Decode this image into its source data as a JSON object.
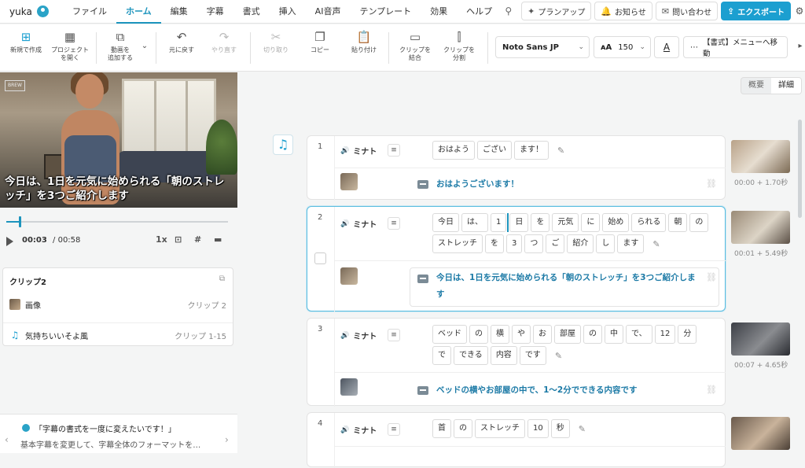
{
  "user": {
    "name": "yuka"
  },
  "menu": [
    "ファイル",
    "ホーム",
    "編集",
    "字幕",
    "書式",
    "挿入",
    "AI音声",
    "テンプレート",
    "効果",
    "ヘルプ"
  ],
  "header_actions": {
    "plan": "プランアップ",
    "notice": "お知らせ",
    "contact": "問い合わせ",
    "export": "エクスポート"
  },
  "toolbar": {
    "new": "新規で作成",
    "open": [
      "プロジェクト",
      "を開く"
    ],
    "add_video": [
      "動画を",
      "追加する"
    ],
    "undo": "元に戻す",
    "redo": "やり直す",
    "cut": "切り取り",
    "copy": "コピー",
    "paste": "貼り付け",
    "merge": [
      "クリップを",
      "結合"
    ],
    "split": [
      "クリップを",
      "分割"
    ],
    "font": "Noto Sans JP",
    "font_size": "150",
    "format_menu": "【書式】メニューへ移動"
  },
  "preview": {
    "caption": "今日は、1日を元気に始められる「朝のストレッチ」を3つご紹介します",
    "logo": "BREW"
  },
  "player": {
    "current": "00:03",
    "total": "/ 00:58",
    "speed": "1x",
    "progress": 0.06
  },
  "clip_panel": {
    "title": "クリップ2",
    "rows": [
      {
        "label": "画像",
        "right": "クリップ 2"
      },
      {
        "label": "気持ちいいそよ風",
        "right": "クリップ 1-15"
      }
    ]
  },
  "tip": {
    "title": "「字幕の書式を一度に変えたいです！」",
    "body": "基本字幕を変更して、字幕全体のフォーマットを…"
  },
  "view_toggle": {
    "summary": "概要",
    "detail": "詳細"
  },
  "clips": [
    {
      "num": "1",
      "speaker": "ミナト",
      "words": [
        "おはよう",
        "ござい",
        "ます！"
      ],
      "subtitle": "おはようございます！",
      "time": "00:00 + 1.70秒"
    },
    {
      "num": "2",
      "speaker": "ミナト",
      "words": [
        "今日",
        "は、",
        "1",
        "日",
        "を",
        "元気",
        "に",
        "始め",
        "られる",
        "朝",
        "の",
        "ストレッチ",
        "を",
        "3",
        "つ",
        "ご",
        "紹介",
        "し",
        "ます"
      ],
      "subtitle": "今日は、1日を元気に始められる「朝のストレッチ」を3つご紹介します",
      "time": "00:01 + 5.49秒"
    },
    {
      "num": "3",
      "speaker": "ミナト",
      "words": [
        "ベッド",
        "の",
        "横",
        "や",
        "お",
        "部屋",
        "の",
        "中",
        "で、",
        "12",
        "分",
        "で",
        "できる",
        "内容",
        "です"
      ],
      "subtitle": "ベッドの横やお部屋の中で、1〜2分でできる内容です",
      "time": "00:07 + 4.65秒"
    },
    {
      "num": "4",
      "speaker": "ミナト",
      "words": [
        "首",
        "の",
        "ストレッチ",
        "10",
        "秒"
      ],
      "subtitle": "",
      "time": ""
    }
  ],
  "colors": {
    "accent": "#1c94bd",
    "export": "#1c9fd0"
  }
}
